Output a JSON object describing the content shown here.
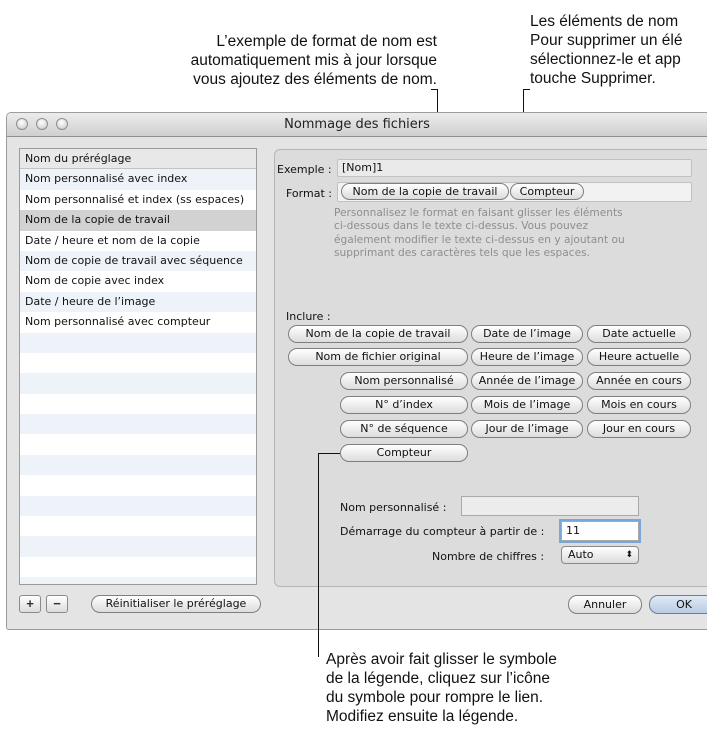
{
  "callouts": {
    "top_left": [
      "L’exemple de format de nom est",
      "automatiquement mis à jour lorsque",
      "vous ajoutez des éléments de nom."
    ],
    "top_right": [
      "Les éléments de nom",
      "Pour supprimer un élé",
      "sélectionnez-le et app",
      "touche Supprimer."
    ],
    "bottom": [
      "Après avoir fait glisser le symbole",
      "de la légende, cliquez sur l’icône",
      "du symbole pour rompre le lien.",
      "Modifiez ensuite la légende."
    ]
  },
  "window": {
    "title": "Nommage des fichiers"
  },
  "presets": {
    "header": "Nom du préréglage",
    "items": [
      "Nom personnalisé avec index",
      "Nom personnalisé et index (ss espaces)",
      "Nom de la copie de travail",
      "Date / heure et nom de la copie",
      "Nom de copie de travail avec séquence",
      "Nom de copie avec index",
      "Date / heure de l’image",
      "Nom personnalisé avec compteur"
    ],
    "selected_index": 2,
    "add_label": "+",
    "remove_label": "−",
    "reset_label": "Réinitialiser le préréglage"
  },
  "format_panel": {
    "example_label": "Exemple :",
    "example_value": "[Nom]1",
    "format_label": "Format :",
    "format_tokens": [
      "Nom de la copie de travail",
      "Compteur"
    ],
    "hint_lines": [
      "Personnalisez le format en faisant glisser les éléments",
      "ci-dessous dans le texte ci-dessus. Vous pouvez",
      "également modifier le texte ci-dessus en y ajoutant ou",
      "supprimant des caractères tels que les espaces."
    ],
    "include_label": "Inclure :",
    "tokens": {
      "r1": [
        "Nom de la copie de travail",
        "Date de l’image",
        "Date actuelle"
      ],
      "r2": [
        "Nom de fichier original",
        "Heure de l’image",
        "Heure actuelle"
      ],
      "r3": [
        "Nom personnalisé",
        "Année de l’image",
        "Année en cours"
      ],
      "r4": [
        "N° d’index",
        "Mois de l’image",
        "Mois en cours"
      ],
      "r5": [
        "N° de séquence",
        "Jour de l’image",
        "Jour en cours"
      ],
      "r6": [
        "Compteur"
      ]
    },
    "custom_name_label": "Nom personnalisé :",
    "custom_name_value": "",
    "counter_start_label": "Démarrage du compteur à partir de :",
    "counter_start_value": "11",
    "digits_label": "Nombre de chiffres :",
    "digits_value": "Auto"
  },
  "buttons": {
    "cancel": "Annuler",
    "ok": "OK"
  }
}
